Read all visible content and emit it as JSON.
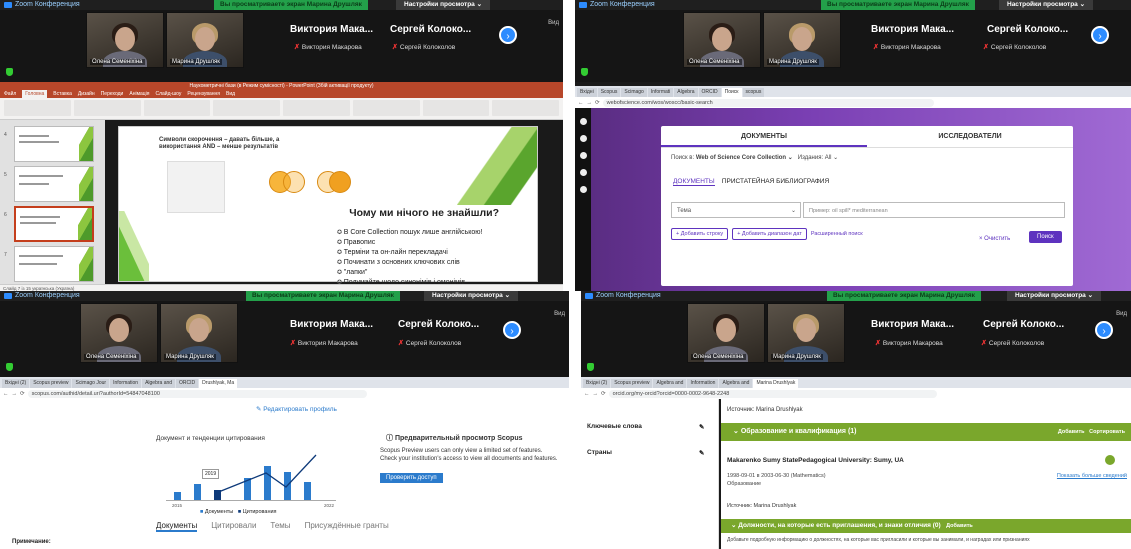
{
  "zoom": {
    "app_title": "Zoom Конференция",
    "viewing_banner": "Вы просматриваете экран Марина Друшляк",
    "view_options": "Настройки просмотра ⌄",
    "view_label": "Вид",
    "participants": [
      {
        "name": "Олена Семенiхiна"
      },
      {
        "name": "Марина Друшляк"
      }
    ],
    "big_names": [
      "Виктория Мака...",
      "Сергей Колоко..."
    ],
    "small_names": [
      "Виктория Макарова",
      "Сергей Колоколов"
    ],
    "big_names_q2": [
      "Виктория Мака...",
      "Сергей Колоко..."
    ],
    "big_names_q3": [
      "Виктория Мака...",
      "Сергей Колоко..."
    ],
    "big_names_q4": [
      "Виктория Мака...",
      "Сергей Колоко..."
    ]
  },
  "ppt": {
    "title_bar": "Наукометричні бази (в Режим сумісності) - PowerPoint (Збій активації продукту)",
    "tabs": [
      "Файл",
      "Головна",
      "Вставка",
      "Дизайн",
      "Переходи",
      "Анімація",
      "Слайд-шоу",
      "Рецензування",
      "Вид"
    ],
    "slide_title": "Символи скорочення – давать більше, а використання AND – менше результатів",
    "heading": "Чому ми нічого не знайшли?",
    "bullets": [
      "В Core Collection пошук лише англійською!",
      "Правопис",
      "Терміни та он-лайн перекладачі",
      "Починати з основних ключових слів",
      "\"лапки\"",
      "Подумайте щодо синонімів і омонімів"
    ],
    "status": "Слайд 7 із 15   українська (Україна)"
  },
  "wos": {
    "url": "webofscience.com/wos/woscc/basic-search",
    "tab_docs": "ДОКУМЕНТЫ",
    "tab_researchers": "ИССЛЕДОВАТЕЛИ",
    "search_in": "Поиск в:",
    "collection": "Web of Science Core Collection ⌄",
    "editions": "Издания: All ⌄",
    "subtab_docs": "ДОКУМЕНТЫ",
    "subtab_cited": "ПРИСТАТЕЙНАЯ БИБЛИОГРАФИЯ",
    "field": "Тема",
    "placeholder": "Пример: oil spill* mediterranean",
    "add_row": "+ Добавить строку",
    "add_date": "+ Добавить диапазон дат",
    "advanced": "Расширенный поиск",
    "clear": "× Очистить",
    "search": "Поиск"
  },
  "scopus": {
    "url": "scopus.com/authid/detail.uri?authorId=54847048100",
    "edit_profile": "Редактировать профиль",
    "chart_title": "Документ и тенденции цитирования",
    "legend_docs": "Документы",
    "legend_cites": "Цитирования",
    "tooltip": "2019",
    "x_start": "2015",
    "x_end": "2022",
    "preview_title": "Предварительный просмотр Scopus",
    "preview_text": "Scopus Preview users can only view a limited set of features. Check your institution's access to view all documents and features.",
    "check_access": "Проверить доступ",
    "tabs": [
      "Документы",
      "Цитировали",
      "Темы",
      "Присуждённые гранты"
    ],
    "note": "Примечание:"
  },
  "orcid": {
    "url": "orcid.org/my-orcid?orcid=0000-0002-9648-2248",
    "source_top": "Источник: Marina Drushlyak",
    "keywords": "Ключевые слова",
    "countries": "Страны",
    "section_edu": "Образование и квалификация (1)",
    "add": "Добавить",
    "sort": "Сортировать",
    "institution": "Makarenko Sumy StatePedagogical University: Sumy, UA",
    "dates": "1998-09-01 в 2003-06-30 (Mathematics)",
    "type": "Образование",
    "show_more": "Показать больше сведений",
    "source": "Источник: Marina Drushlyak",
    "section_invites": "Должности, на которые есть приглашения, и знаки отличия (0)",
    "add2": "Добавить",
    "footer": "Добавьте подробную информацию о должностях, на которые вас пригласили и которые вы занимали, и наградах или признаниях"
  },
  "colors": {
    "zoom_green": "#23a04a",
    "zoom_blue": "#2d8cff",
    "ppt_red": "#b7472a",
    "wos_purple": "#5e33bf",
    "scopus_blue": "#2b7bcc",
    "orcid_green": "#7aa72c"
  }
}
